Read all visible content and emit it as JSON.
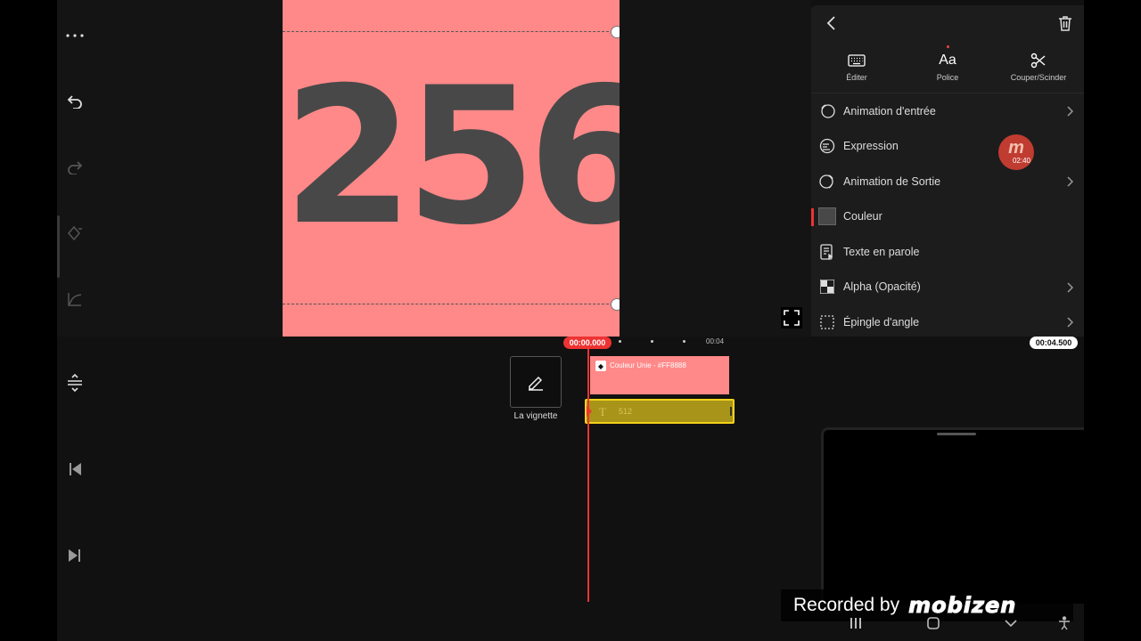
{
  "canvas": {
    "big_text": "256",
    "background": "#ff8888",
    "text_color": "#484848"
  },
  "panel": {
    "tabs": [
      {
        "label": "Éditer",
        "icon": "keyboard-icon"
      },
      {
        "label": "Police",
        "icon": "font-icon"
      },
      {
        "label": "Couper/Scinder",
        "icon": "scissors-icon"
      }
    ],
    "items": [
      {
        "label": "Animation d'entrée",
        "icon": "enter-animation-icon"
      },
      {
        "label": "Expression",
        "icon": "expression-icon"
      },
      {
        "label": "Animation de Sortie",
        "icon": "exit-animation-icon"
      },
      {
        "label": "Couleur",
        "icon": "color-swatch"
      },
      {
        "label": "Texte en parole",
        "icon": "text-to-speech-icon"
      },
      {
        "label": "Alpha (Opacité)",
        "icon": "alpha-icon"
      },
      {
        "label": "Épingle d'angle",
        "icon": "corner-pin-icon"
      }
    ]
  },
  "bubble": {
    "logo": "m",
    "time": "02:40"
  },
  "timeline": {
    "current_time": "00:00.000",
    "duration": "00:04.500",
    "ruler_label": "00:04",
    "thumbnail_label": "La vignette",
    "clips": {
      "color_clip_label": "Couleur Unie - #FF8888",
      "text_clip_label": "512"
    }
  },
  "watermark": {
    "recorded_by": "Recorded by",
    "brand": "mobizen"
  },
  "colors": {
    "accent": "#e33333",
    "text_clip": "#a89418",
    "text_clip_border": "#f2d21a",
    "panel_bg": "#1c1c1c"
  }
}
